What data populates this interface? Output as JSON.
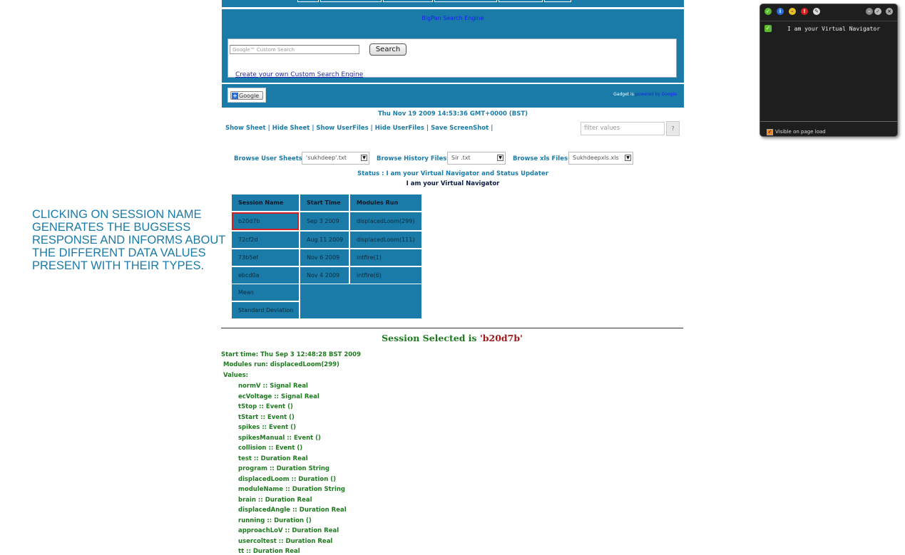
{
  "search": {
    "engine_title": "BigPan Search Engine",
    "placeholder": "Google™ Custom Search",
    "button_label": "Search",
    "create_link": "Create your own Custom Search Engine"
  },
  "gadget": {
    "add_button_label": "Google",
    "powered_prefix": "Gadget is",
    "powered_link": "powered by Google"
  },
  "header": {
    "date": "Thu Nov 19 2009 14:53:36 GMT+0000 (BST)"
  },
  "toolbar": {
    "links": [
      "Show Sheet",
      "Hide Sheet",
      "Show UserFiles",
      "Hide UserFiles",
      "Save ScreenShot"
    ],
    "filter_placeholder": "filter values",
    "help_label": "?"
  },
  "browse": {
    "user_sheets_label": "Browse User Sheets",
    "user_sheets_value": "'sukhdeep'.txt",
    "history_label": "Browse History Files",
    "history_value": "Sir .txt",
    "xls_label": "Browse xls Files",
    "xls_value": "Sukhdeepxls.xls"
  },
  "status": {
    "line": "Status : I am your Virtual Navigator and Status Updater",
    "navigator": "I am your Virtual Navigator"
  },
  "table": {
    "headers": [
      "Session Name",
      "Start Time",
      "Modules Run"
    ],
    "rows": [
      {
        "session": "b20d7b",
        "start": "Sep 3 2009",
        "modules": "displacedLoom(299)"
      },
      {
        "session": "72cf2d",
        "start": "Aug 11 2009",
        "modules": "displacedLoom(111)"
      },
      {
        "session": "73b5ef",
        "start": "Nov 6 2009",
        "modules": "intfire(1)"
      },
      {
        "session": "ebcd0a",
        "start": "Nov 4 2009",
        "modules": "intfire(6)"
      }
    ],
    "stats": [
      "Mean",
      "Standard Deviation"
    ]
  },
  "annotation": "CLICKING ON SESSION NAME GENERATES THE BUGSESS RESPONSE AND INFORMS ABOUT THE DIFFERENT DATA VALUES PRESENT WITH THEIR TYPES.",
  "selection": {
    "prefix": "Session Selected is ",
    "session_id": "'b20d7b'",
    "start_time": "Start time: Thu Sep  3 12:48:28 BST 2009",
    "modules_run": "Modules run: displacedLoom(299)",
    "values_label": "Values:",
    "values": [
      "normV :: Signal Real",
      "ecVoltage :: Signal Real",
      "tStop :: Event ()",
      "tStart :: Event ()",
      "spikes :: Event ()",
      "spikesManual :: Event ()",
      "collision :: Event ()",
      "test :: Duration Real",
      "program :: Duration String",
      "displacedLoom :: Duration ()",
      "moduleName :: Duration String",
      "brain :: Duration Real",
      "displacedAngle :: Duration Real",
      "running :: Duration ()",
      "approachLoV :: Duration Real",
      "usercoltest :: Duration Real",
      "tt :: Duration Real"
    ]
  },
  "navigator_widget": {
    "message": "I am your Virtual Navigator",
    "visible_label": "Visible on page load",
    "visible_checked": true
  },
  "colors": {
    "brand_blue": "#1a7ba8",
    "selection_green": "#1e7a1e",
    "selection_red": "#a01818"
  }
}
